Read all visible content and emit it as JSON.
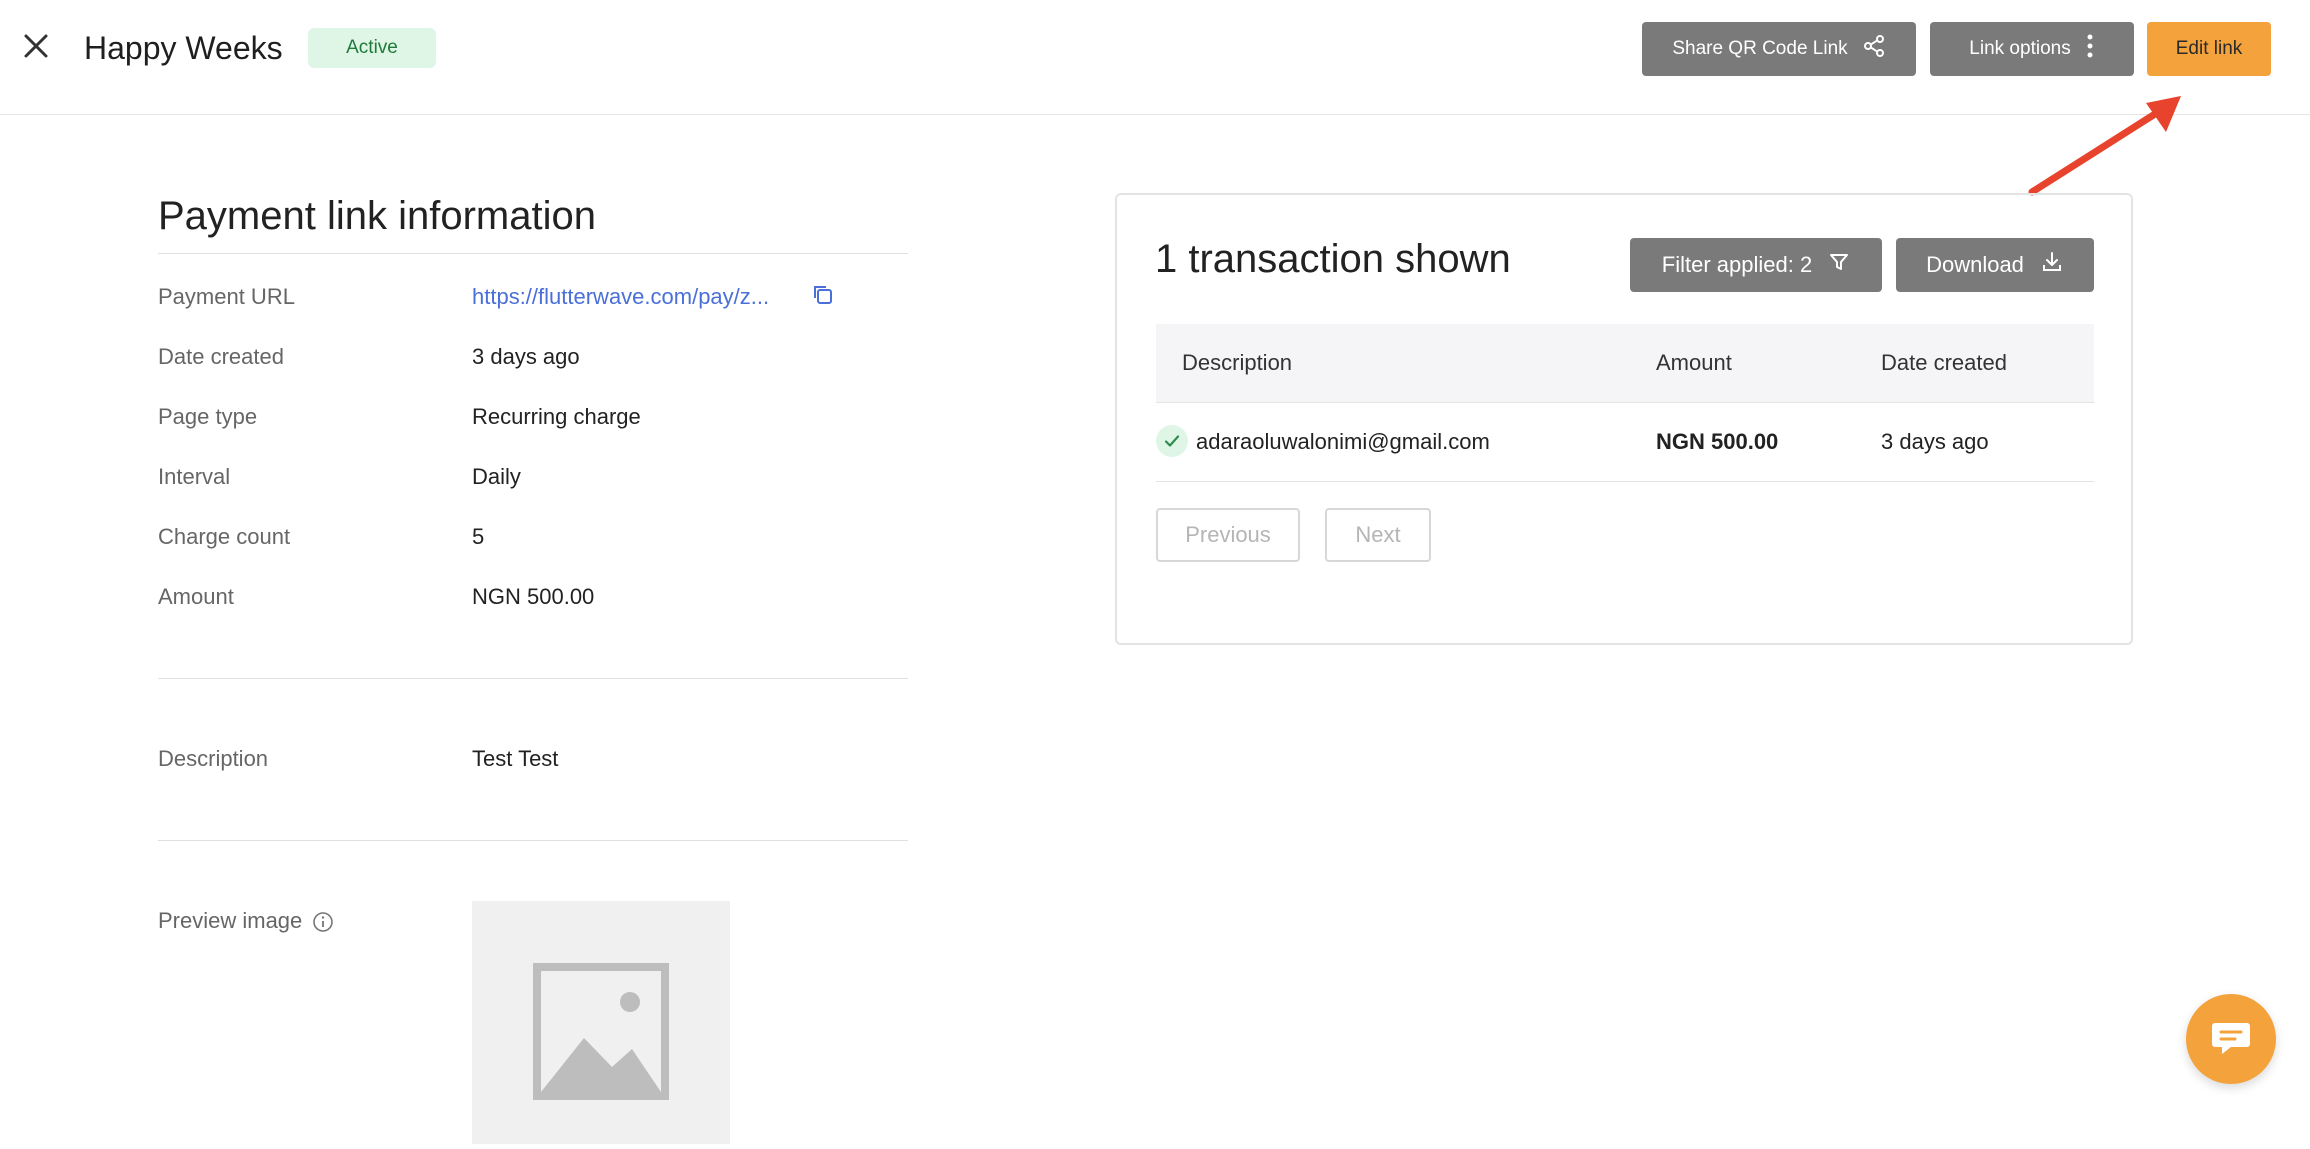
{
  "header": {
    "title": "Happy Weeks",
    "status": "Active",
    "share_label": "Share QR Code Link",
    "options_label": "Link options",
    "edit_label": "Edit link"
  },
  "info": {
    "title": "Payment link information",
    "rows": [
      {
        "label": "Payment URL",
        "value": "https://flutterwave.com/pay/z..."
      },
      {
        "label": "Date created",
        "value": "3 days ago"
      },
      {
        "label": "Page type",
        "value": "Recurring charge"
      },
      {
        "label": "Interval",
        "value": "Daily"
      },
      {
        "label": "Charge count",
        "value": "5"
      },
      {
        "label": "Amount",
        "value": "NGN 500.00"
      }
    ],
    "description_label": "Description",
    "description_value": "Test Test",
    "preview_label": "Preview image"
  },
  "transactions": {
    "title": "1 transaction shown",
    "filter_label": "Filter applied: 2",
    "download_label": "Download",
    "columns": [
      "Description",
      "Amount",
      "Date created"
    ],
    "rows": [
      {
        "description": "adaraoluwalonimi@gmail.com",
        "amount": "NGN 500.00",
        "date": "3 days ago",
        "status": "success"
      }
    ],
    "previous_label": "Previous",
    "next_label": "Next"
  },
  "colors": {
    "accent": "#f4a23b",
    "button_gray": "#7a7a7a",
    "link": "#4a6fd8",
    "success_bg": "#dff6e6",
    "annotation_arrow": "#e8432d"
  }
}
